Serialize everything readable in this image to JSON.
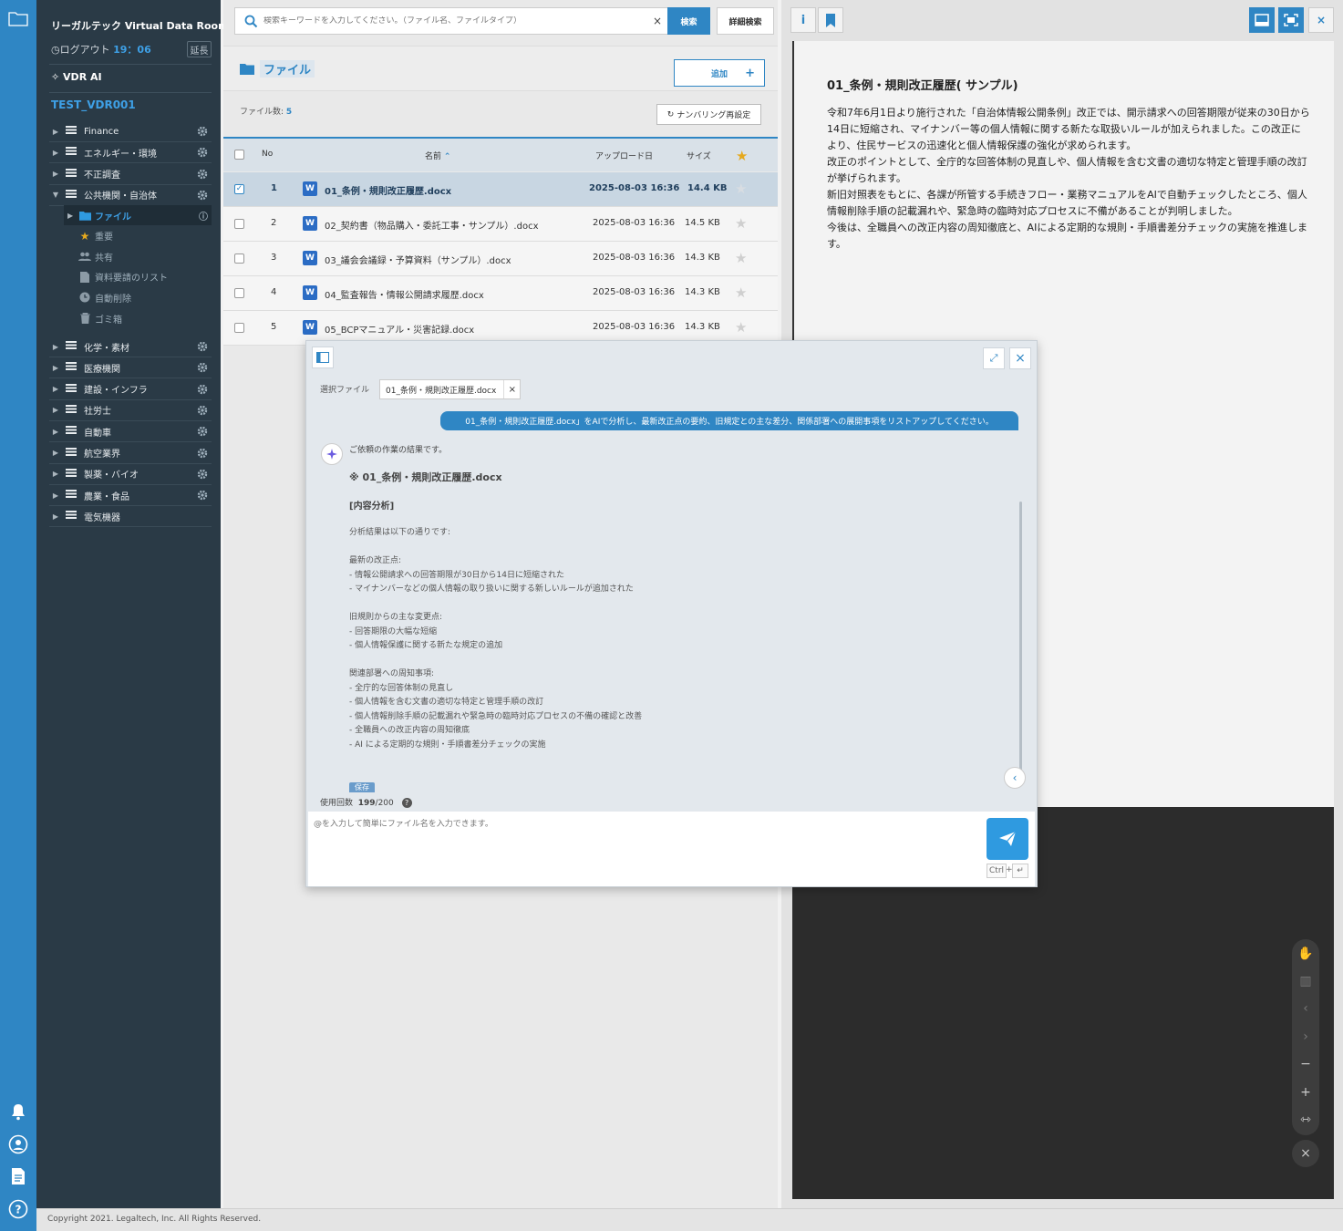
{
  "sidebar": {
    "title": "リーガルテック Virtual Data Room",
    "logout_label": "ログアウト",
    "logout_time": "19：06",
    "extend_label": "延長",
    "ai_label": "VDR AI",
    "project": "TEST_VDR001",
    "folders_top": [
      "Finance",
      "エネルギー・環境",
      "不正調査",
      "公共機関・自治体"
    ],
    "subitems": [
      "ファイル",
      "重要",
      "共有",
      "資料要請のリスト",
      "自動削除",
      "ゴミ箱"
    ],
    "folders_bottom": [
      "化学・素材",
      "医療機関",
      "建設・インフラ",
      "社労士",
      "自動車",
      "航空業界",
      "製薬・バイオ",
      "農業・食品",
      "電気機器"
    ]
  },
  "search": {
    "placeholder": "検索キーワードを入力してください。（ファイル名、ファイルタイプ）",
    "button": "検索",
    "advanced": "詳細検索"
  },
  "folder": {
    "title": "ファイル",
    "add": "追加",
    "count_label": "ファイル数:",
    "count": "5",
    "renumber": "ナンバリング再設定"
  },
  "table": {
    "headers": {
      "no": "No",
      "name": "名前",
      "date": "アップロード日",
      "size": "サイズ"
    },
    "rows": [
      {
        "no": "1",
        "name": "01_条例・規則改正履歴.docx",
        "date": "2025-08-03 16:36",
        "size": "14.4 KB",
        "selected": true
      },
      {
        "no": "2",
        "name": "02_契約書（物品購入・委託工事・サンプル）.docx",
        "date": "2025-08-03 16:36",
        "size": "14.5 KB",
        "selected": false
      },
      {
        "no": "3",
        "name": "03_議会会議録・予算資料（サンプル）.docx",
        "date": "2025-08-03 16:36",
        "size": "14.3 KB",
        "selected": false
      },
      {
        "no": "4",
        "name": "04_監査報告・情報公開請求履歴.docx",
        "date": "2025-08-03 16:36",
        "size": "14.3 KB",
        "selected": false
      },
      {
        "no": "5",
        "name": "05_BCPマニュアル・災害記録.docx",
        "date": "2025-08-03 16:36",
        "size": "14.3 KB",
        "selected": false
      }
    ]
  },
  "viewer": {
    "doc_title": "01_条例・規則改正履歴( サンプル)",
    "doc_body": [
      "令和7年6月1日より施行された「自治体情報公開条例」改正では、開示請求への回答期限が従来の30日から14日に短縮され、マイナンバー等の個人情報に関する新たな取扱いルールが加えられました。この改正により、住民サービスの迅速化と個人情報保護の強化が求められます。",
      "改正のポイントとして、全庁的な回答体制の見直しや、個人情報を含む文書の適切な特定と管理手順の改訂が挙げられます。",
      "新旧対照表をもとに、各課が所管する手続きフロー・業務マニュアルをAIで自動チェックしたところ、個人情報削除手順の記載漏れや、緊急時の臨時対応プロセスに不備があることが判明しました。",
      "今後は、全職員への改正内容の周知徹底と、AIによる定期的な規則・手順書差分チェックの実施を推進します。"
    ]
  },
  "ai_panel": {
    "selected_label": "選択ファイル",
    "selected_file": "01_条例・規則改正履歴.docx",
    "user_message": "01_条例・規則改正履歴.docx」をAIで分析し、最新改正点の要約、旧規定との主な差分、関係部署への展開事項をリストアップしてください。",
    "intro": "ご依頼の作業の結果です。",
    "file_heading": "※ 01_条例・規則改正履歴.docx",
    "section": "[内容分析]",
    "body": "分析結果は以下の通りです:\n\n最新の改正点:\n- 情報公開請求への回答期限が30日から14日に短縮された\n- マイナンバーなどの個人情報の取り扱いに関する新しいルールが追加された\n\n旧規則からの主な変更点:\n- 回答期限の大幅な短縮\n- 個人情報保護に関する新たな規定の追加\n\n関連部署への周知事項:\n- 全庁的な回答体制の見直し\n- 個人情報を含む文書の適切な特定と管理手順の改訂\n- 個人情報削除手順の記載漏れや緊急時の臨時対応プロセスの不備の確認と改善\n- 全職員への改正内容の周知徹底\n- AI による定期的な規則・手順書差分チェックの実施",
    "save_label": "保存",
    "usage_label": "使用回数",
    "usage_count": "199",
    "usage_limit": "/200",
    "input_placeholder": "@を入力して簡単にファイル名を入力できます。",
    "kbd_ctrl": "Ctrl",
    "kbd_plus": "+",
    "kbd_enter": "↵"
  },
  "footer": "Copyright 2021. Legaltech, Inc. All Rights Reserved.",
  "colors": {
    "accent": "#2f86c4",
    "sidebar": "#2a3a46",
    "rail": "#2f86c4"
  }
}
